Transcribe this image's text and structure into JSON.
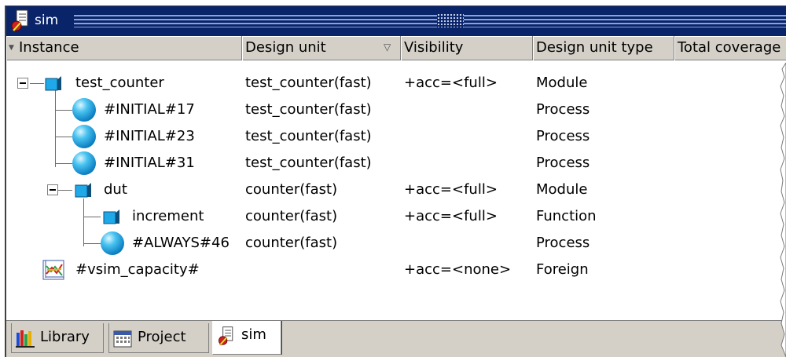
{
  "window": {
    "title": "sim",
    "title_icon": "sim-tab-icon"
  },
  "columns": [
    {
      "label": "Instance"
    },
    {
      "label": "Design unit"
    },
    {
      "label": "Visibility"
    },
    {
      "label": "Design unit type"
    },
    {
      "label": "Total coverage"
    }
  ],
  "rows": [
    {
      "instance": "test_counter",
      "design_unit": "test_counter(fast)",
      "visibility": "+acc=<full>",
      "type": "Module",
      "icon": "module-icon"
    },
    {
      "instance": "#INITIAL#17",
      "design_unit": "test_counter(fast)",
      "visibility": "",
      "type": "Process",
      "icon": "process-icon"
    },
    {
      "instance": "#INITIAL#23",
      "design_unit": "test_counter(fast)",
      "visibility": "",
      "type": "Process",
      "icon": "process-icon"
    },
    {
      "instance": "#INITIAL#31",
      "design_unit": "test_counter(fast)",
      "visibility": "",
      "type": "Process",
      "icon": "process-icon"
    },
    {
      "instance": "dut",
      "design_unit": "counter(fast)",
      "visibility": "+acc=<full>",
      "type": "Module",
      "icon": "module-icon"
    },
    {
      "instance": "increment",
      "design_unit": "counter(fast)",
      "visibility": "+acc=<full>",
      "type": "Function",
      "icon": "function-icon"
    },
    {
      "instance": "#ALWAYS#46",
      "design_unit": "counter(fast)",
      "visibility": "",
      "type": "Process",
      "icon": "process-icon"
    },
    {
      "instance": "#vsim_capacity#",
      "design_unit": "",
      "visibility": "+acc=<none>",
      "type": "Foreign",
      "icon": "foreign-icon"
    }
  ],
  "tabs": [
    {
      "label": "Library",
      "icon": "library-icon",
      "active": false
    },
    {
      "label": "Project",
      "icon": "project-icon",
      "active": false
    },
    {
      "label": "sim",
      "icon": "sim-icon",
      "active": true
    }
  ],
  "colors": {
    "titlebar": "#0a246a",
    "chrome": "#d4d0c8",
    "sphere": "#0f83c6",
    "module": "#1fa9e8"
  }
}
